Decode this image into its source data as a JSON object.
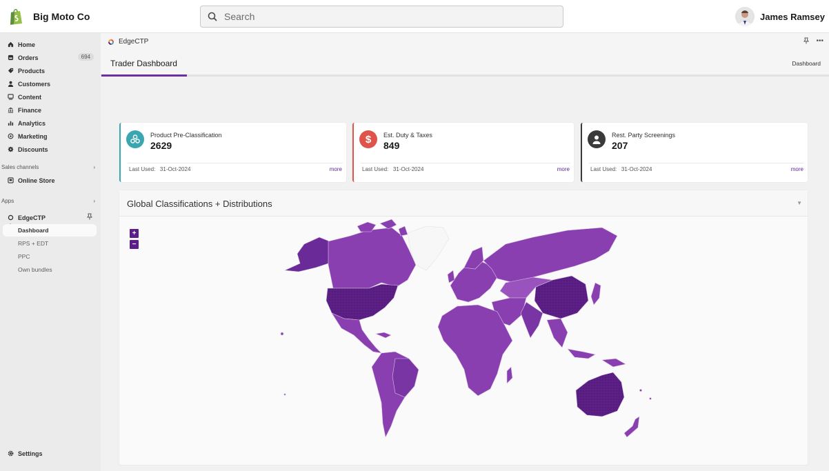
{
  "topbar": {
    "store_name": "Big Moto Co",
    "search_placeholder": "Search",
    "user_name": "James Ramsey"
  },
  "sidebar": {
    "items": [
      {
        "label": "Home",
        "icon": "home-icon"
      },
      {
        "label": "Orders",
        "icon": "orders-icon",
        "badge": "694"
      },
      {
        "label": "Products",
        "icon": "tag-icon"
      },
      {
        "label": "Customers",
        "icon": "person-icon"
      },
      {
        "label": "Content",
        "icon": "content-icon"
      },
      {
        "label": "Finance",
        "icon": "bank-icon"
      },
      {
        "label": "Analytics",
        "icon": "bar-chart-icon"
      },
      {
        "label": "Marketing",
        "icon": "target-icon"
      },
      {
        "label": "Discounts",
        "icon": "discount-icon"
      }
    ],
    "sales_channels_label": "Sales channels",
    "online_store_label": "Online Store",
    "apps_label": "Apps",
    "app_name": "EdgeCTP",
    "sub_items": [
      "Dashboard",
      "RPS + EDT",
      "PPC",
      "Own bundles"
    ],
    "settings_label": "Settings"
  },
  "app_strip": {
    "app_name": "EdgeCTP"
  },
  "header": {
    "title": "Trader Dashboard",
    "crumb": "Dashboard"
  },
  "cards": [
    {
      "title": "Product Pre-Classification",
      "value": "2629",
      "last_used_label": "Last Used:",
      "last_used": "31-Oct-2024",
      "more": "more",
      "color": "#3aa6b0",
      "icon": "classification-icon"
    },
    {
      "title": "Est. Duty & Taxes",
      "value": "849",
      "last_used_label": "Last Used:",
      "last_used": "31-Oct-2024",
      "more": "more",
      "color": "#e0534a",
      "icon": "dollar-icon"
    },
    {
      "title": "Rest. Party Screenings",
      "value": "207",
      "last_used_label": "Last Used:",
      "last_used": "31-Oct-2024",
      "more": "more",
      "color": "#3a3a3a",
      "icon": "user-circle-icon"
    }
  ],
  "map": {
    "title": "Global Classifications + Distributions",
    "zoom_in": "+",
    "zoom_out": "−",
    "fill_color": "#8a3fb0",
    "highlight_color": "#5b1f86"
  }
}
